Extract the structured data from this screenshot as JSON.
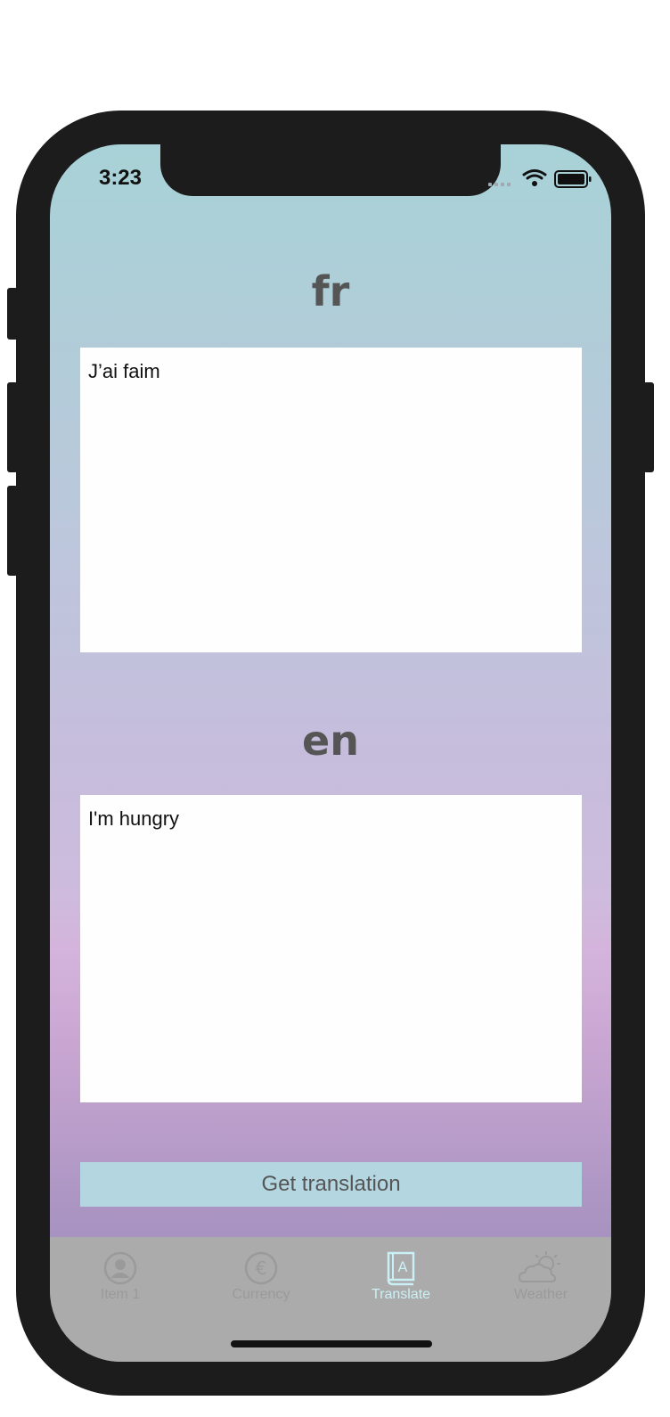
{
  "status_bar": {
    "time": "3:23"
  },
  "source": {
    "language": "fr",
    "text": "J’ai faim"
  },
  "target": {
    "language": "en",
    "text": "I'm hungry"
  },
  "actions": {
    "translate_label": "Get translation"
  },
  "tab_bar": {
    "items": [
      {
        "label": "Item 1",
        "icon": "person-icon",
        "active": false
      },
      {
        "label": "Currency",
        "icon": "euro-icon",
        "active": false
      },
      {
        "label": "Translate",
        "icon": "book-icon",
        "active": true
      },
      {
        "label": "Weather",
        "icon": "weather-icon",
        "active": false
      }
    ],
    "active_color": "#c9f0f5",
    "inactive_color": "#9a9a9a"
  }
}
